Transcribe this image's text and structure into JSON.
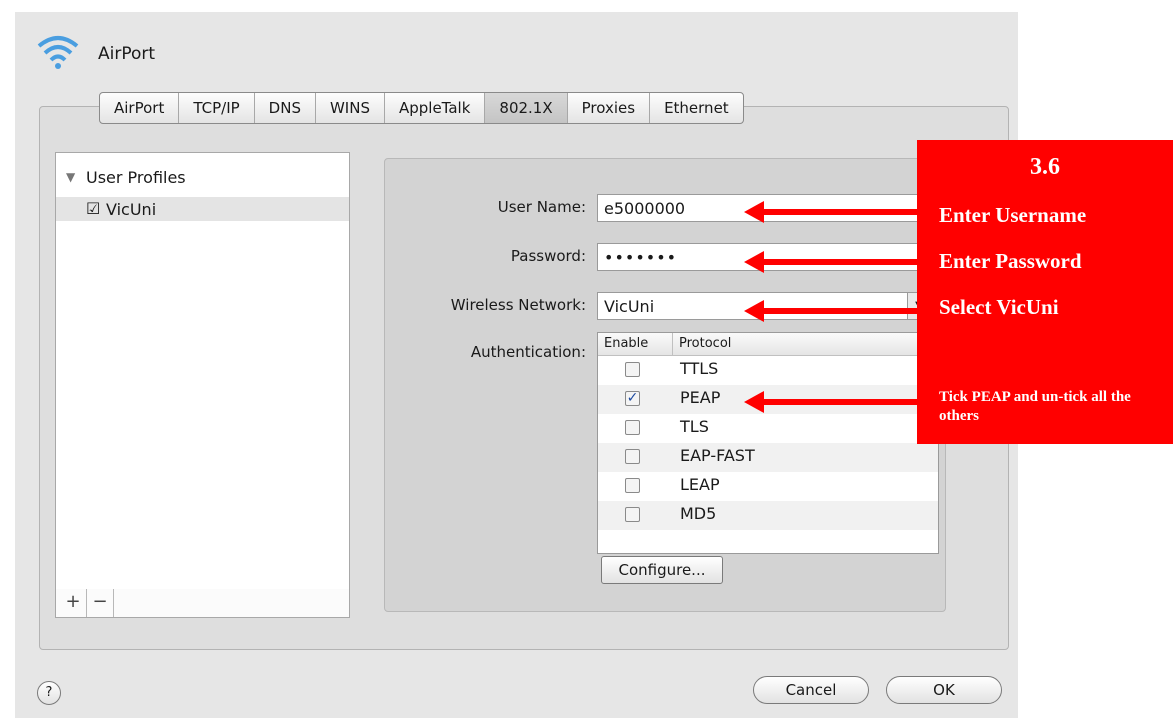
{
  "window": {
    "title": "AirPort"
  },
  "tabs": [
    {
      "label": "AirPort",
      "selected": false
    },
    {
      "label": "TCP/IP",
      "selected": false
    },
    {
      "label": "DNS",
      "selected": false
    },
    {
      "label": "WINS",
      "selected": false
    },
    {
      "label": "AppleTalk",
      "selected": false
    },
    {
      "label": "802.1X",
      "selected": true
    },
    {
      "label": "Proxies",
      "selected": false
    },
    {
      "label": "Ethernet",
      "selected": false
    }
  ],
  "profiles": {
    "group_label": "User Profiles",
    "items": [
      {
        "label": "VicUni",
        "checked": true
      }
    ],
    "add_label": "+",
    "remove_label": "−"
  },
  "form": {
    "username_label": "User Name:",
    "username_value": "e5000000",
    "password_label": "Password:",
    "password_value": "•••••••",
    "network_label": "Wireless Network:",
    "network_value": "VicUni",
    "auth_label": "Authentication:",
    "auth_headers": {
      "enable": "Enable",
      "protocol": "Protocol"
    },
    "protocols": [
      {
        "name": "TTLS",
        "enabled": false
      },
      {
        "name": "PEAP",
        "enabled": true
      },
      {
        "name": "TLS",
        "enabled": false
      },
      {
        "name": "EAP-FAST",
        "enabled": false
      },
      {
        "name": "LEAP",
        "enabled": false
      },
      {
        "name": "MD5",
        "enabled": false
      }
    ],
    "configure_label": "Configure..."
  },
  "buttons": {
    "help": "?",
    "cancel": "Cancel",
    "ok": "OK"
  },
  "annotation": {
    "step": "3.6",
    "username": "Enter Username",
    "password": "Enter Password",
    "network": "Select VicUni",
    "peap": "Tick PEAP and un-tick all the others",
    "color": "#ff0000"
  }
}
